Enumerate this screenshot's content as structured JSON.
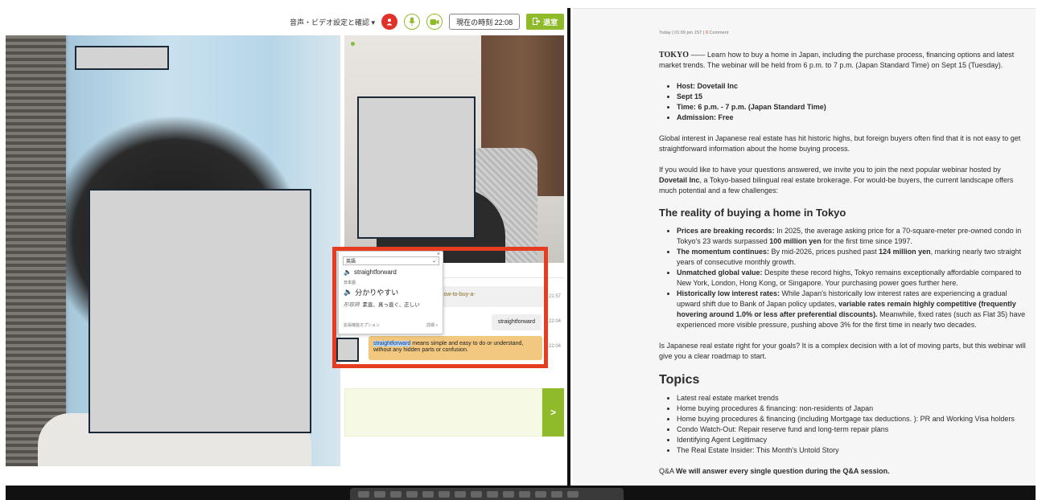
{
  "toolbar": {
    "settings_label": "音声・ビデオ設定と確認",
    "time_label": "現在の時刻 22:08",
    "exit_label": "退室"
  },
  "chat": {
    "messages": [
      {
        "text": "y/features/events/Webinar-how-to-buy-a-",
        "time": "21:57"
      },
      {
        "text": "straightforward",
        "time": "22:04"
      },
      {
        "highlight": "straightforward",
        "text": " means simple and easy to do or understand, without any hidden parts or confusion.",
        "time": "22:04"
      }
    ],
    "send_label": ">"
  },
  "dictionary": {
    "language": "英語",
    "word": "straightforward",
    "target_language": "日本語",
    "translation": "分かりやすい",
    "pos": "形容詞",
    "meanings": "素直、真っ直ぐ、正しい",
    "options_label": "拡張機能オプション",
    "details_label": "詳細 »"
  },
  "article": {
    "meta_prefix": "Today",
    "meta_time": "01:09 pm JST",
    "meta_comments": "0",
    "meta_comment_label": "Comment",
    "lead_city": "TOKYO",
    "lead_text": " —— Learn how to buy a home in Japan, including the purchase process, financing options and latest market trends. The webinar will be held from 6 p.m. to 7 p.m. (Japan Standard Time) on Sept 15 (Tuesday).",
    "details": [
      "Host: Dovetail Inc",
      "Sept 15",
      "Time: 6 p.m. - 7 p.m. (Japan Standard Time)",
      "Admission: Free"
    ],
    "para1": "Global interest in Japanese real estate has hit historic highs, but foreign buyers often find that it is not easy to get straightforward information about the home buying process.",
    "para2_a": "If you would like to have your questions answered, we invite you to join the next popular webinar hosted by ",
    "para2_b": "Dovetail Inc",
    "para2_c": ", a Tokyo-based bilingual real estate brokerage. For would-be buyers, the current landscape offers much potential and a few challenges:",
    "reality_heading": "The reality of buying a home in Tokyo",
    "reality": [
      {
        "b": "Prices are breaking records:",
        "t": " In 2025, the average asking price for a 70-square-meter pre-owned condo in Tokyo's 23 wards surpassed ",
        "b2": "100 million yen",
        "t2": " for the first time since 1997."
      },
      {
        "b": "The momentum continues:",
        "t": " By mid-2026, prices pushed past ",
        "b2": "124 million yen",
        "t2": ", marking nearly two straight years of consecutive monthly growth."
      },
      {
        "b": "Unmatched global value:",
        "t": " Despite these record highs, Tokyo remains exceptionally affordable compared to New York, London, Hong Kong, or Singapore. Your purchasing power goes further here.",
        "b2": "",
        "t2": ""
      },
      {
        "b": "Historically low interest rates:",
        "t": " While Japan's historically low interest rates are experiencing a gradual upward shift due to Bank of Japan policy updates, ",
        "b2": "variable rates remain highly competitive (frequently hovering around 1.0% or less after preferential discounts).",
        "t2": " Meanwhile, fixed rates (such as Flat 35) have experienced more visible pressure, pushing above 3% for the first time in nearly two decades."
      }
    ],
    "para3": "Is Japanese real estate right for your goals? It is a complex decision with a lot of moving parts, but this webinar will give you a clear roadmap to start.",
    "topics_heading": "Topics",
    "topics": [
      "Latest real estate market trends",
      "Home buying procedures & financing: non-residents of Japan",
      "Home buying procedures & financing (including Mortgage tax deductions. ): PR and Working Visa holders",
      "Condo Watch-Out: Repair reserve fund and long-term repair plans",
      "Identifying Agent Legitimacy",
      "The Real Estate Insider: This Month's Untold Story"
    ],
    "qa_prefix": "Q&A",
    "qa_text": "We will answer every single question during the Q&A session."
  },
  "colors": {
    "accent_green": "#8fbb2b",
    "highlight_red": "#e63d21",
    "user_red": "#e0312a",
    "bubble_orange": "#f2c77f"
  },
  "icons": [
    "chevron-down-icon",
    "user-icon",
    "microphone-icon",
    "camera-icon",
    "exit-icon",
    "speaker-icon",
    "close-icon",
    "send-icon"
  ]
}
